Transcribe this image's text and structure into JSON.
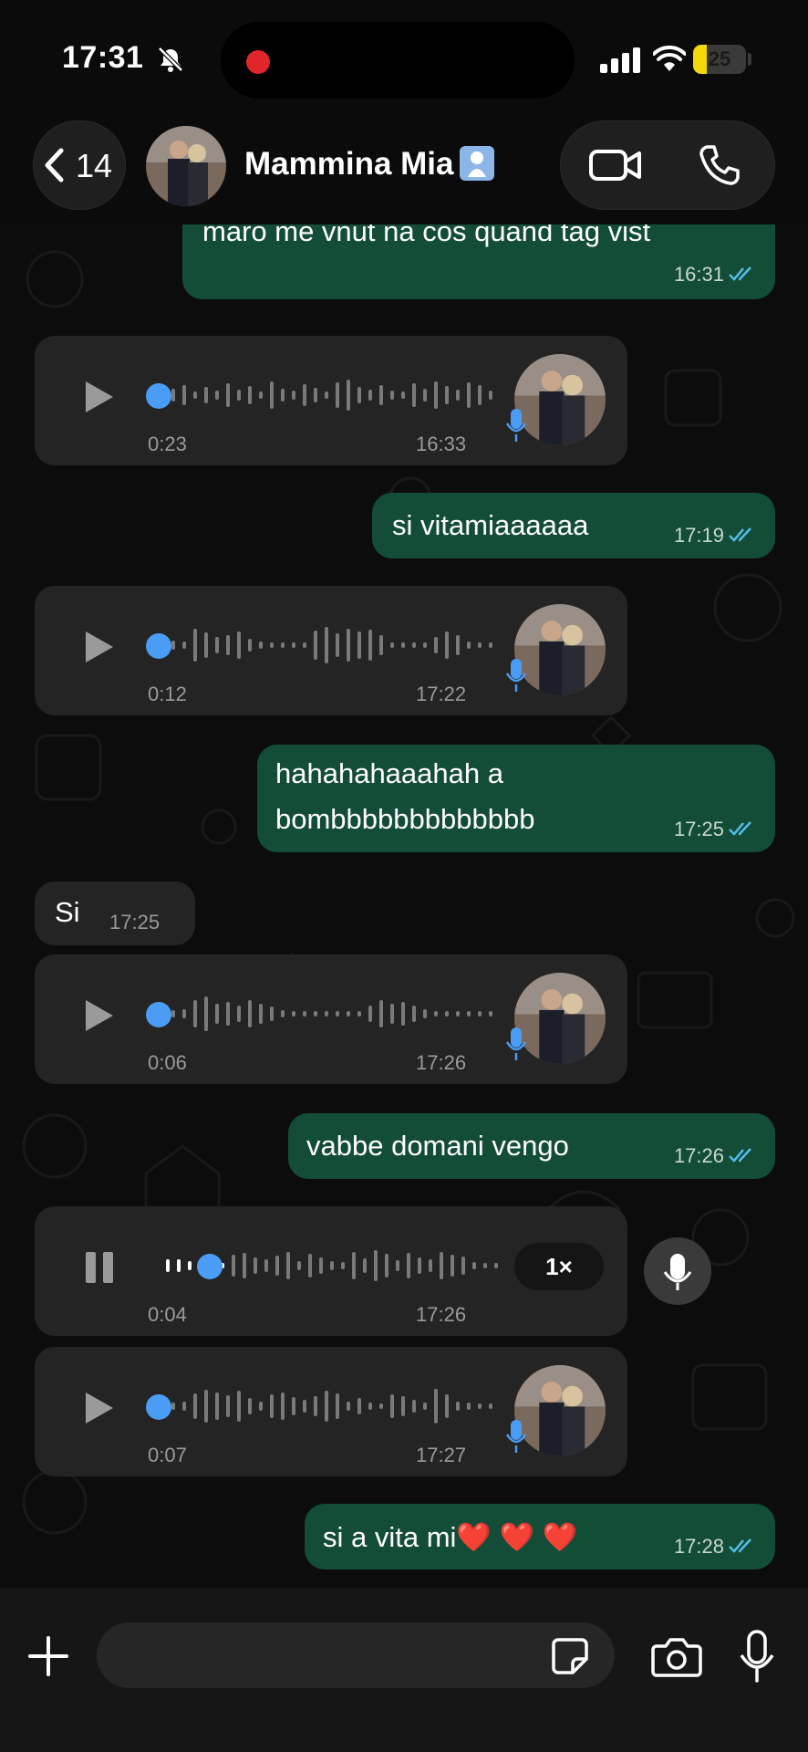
{
  "status_bar": {
    "time": "17:31",
    "battery": "25",
    "battery_level": 0.25
  },
  "header": {
    "back_count": "14",
    "contact_name": "Mammina Mia"
  },
  "messages": [
    {
      "type": "text",
      "direction": "out",
      "text": "maro me vnut na cos quand tag vist",
      "time": "16:31"
    },
    {
      "type": "voice",
      "direction": "in",
      "duration": "0:23",
      "time": "16:33"
    },
    {
      "type": "text",
      "direction": "out",
      "text": "si vitamiaaaaaa",
      "time": "17:19"
    },
    {
      "type": "voice",
      "direction": "in",
      "duration": "0:12",
      "time": "17:22"
    },
    {
      "type": "text",
      "direction": "out",
      "text_line1": "hahahahaaahah a",
      "text_line2": "bombbbbbbbbbbbbb",
      "time": "17:25"
    },
    {
      "type": "text",
      "direction": "in",
      "text": "Si",
      "time": "17:25"
    },
    {
      "type": "voice",
      "direction": "in",
      "duration": "0:06",
      "time": "17:26"
    },
    {
      "type": "text",
      "direction": "out",
      "text": "vabbe domani vengo",
      "time": "17:26"
    },
    {
      "type": "voice",
      "direction": "in",
      "state": "playing",
      "duration": "0:04",
      "time": "17:26",
      "speed": "1×",
      "progress": 0.18
    },
    {
      "type": "voice",
      "direction": "in",
      "duration": "0:07",
      "time": "17:27"
    },
    {
      "type": "text",
      "direction": "out",
      "text": "si a vita mi❤️ ❤️ ❤️",
      "time": "17:28"
    }
  ],
  "composer": {
    "value": "",
    "placeholder": ""
  },
  "colors": {
    "outgoing_bubble": "#134d37",
    "incoming_bubble": "#242424",
    "read_ticks": "#53bdeb",
    "scrubber": "#4a9cf5"
  },
  "icons": [
    "bell-slash-icon",
    "signal-icon",
    "wifi-icon",
    "back-chevron-icon",
    "video-call-icon",
    "phone-icon",
    "play-icon",
    "pause-icon",
    "mic-icon",
    "plus-icon",
    "sticker-icon",
    "camera-icon",
    "read-ticks-icon"
  ]
}
